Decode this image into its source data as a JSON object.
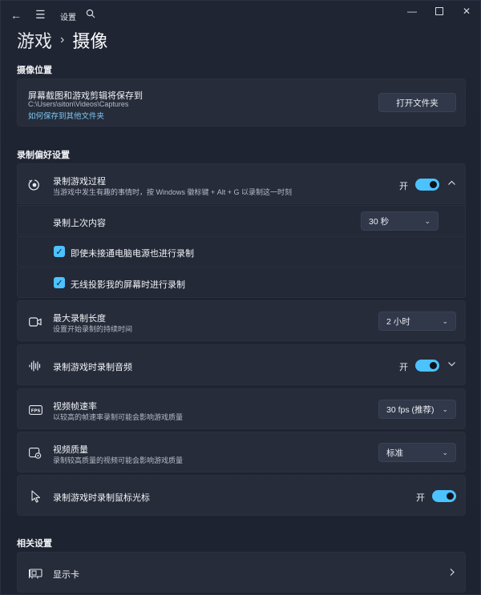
{
  "window": {
    "app_title": "设置",
    "breadcrumb": {
      "parent": "游戏",
      "separator": "›",
      "current": "摄像"
    }
  },
  "capture_location": {
    "section_title": "摄像位置",
    "title": "屏幕截图和游戏剪辑将保存到",
    "path": "C:\\Users\\siton\\Videos\\Captures",
    "link": "如何保存到其他文件夹",
    "button": "打开文件夹"
  },
  "recording_prefs": {
    "section_title": "录制偏好设置",
    "record_what_happened": {
      "title": "录制游戏过程",
      "desc": "当游戏中发生有趣的事情时，按 Windows 徽标键 + Alt + G 以录制这一时刻",
      "toggle_label": "开",
      "toggle_on": true
    },
    "record_last": {
      "title": "录制上次内容",
      "value": "30 秒"
    },
    "checkbox_battery": {
      "label": "即使未接通电脑电源也进行录制",
      "checked": true
    },
    "checkbox_wireless": {
      "label": "无线投影我的屏幕时进行录制",
      "checked": true
    },
    "max_length": {
      "title": "最大录制长度",
      "desc": "设置开始录制的持续时间",
      "value": "2 小时"
    },
    "audio": {
      "title": "录制游戏时录制音频",
      "toggle_label": "开",
      "toggle_on": true
    },
    "framerate": {
      "title": "视频帧速率",
      "desc": "以较高的帧速率录制可能会影响游戏质量",
      "value": "30 fps (推荐)"
    },
    "quality": {
      "title": "视频质量",
      "desc": "录制较高质量的视频可能会影响游戏质量",
      "value": "标准"
    },
    "cursor": {
      "title": "录制游戏时录制鼠标光标",
      "toggle_label": "开",
      "toggle_on": true
    }
  },
  "related": {
    "section_title": "相关设置",
    "graphics": {
      "title": "显示卡"
    }
  },
  "colors": {
    "accent": "#4cc2ff",
    "background": "#1c2230",
    "card": "#262c3a"
  }
}
